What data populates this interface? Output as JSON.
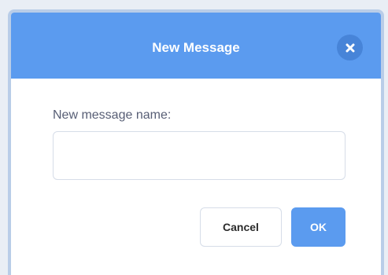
{
  "dialog": {
    "title": "New Message",
    "close_icon": "close-icon",
    "field_label": "New message name:",
    "input_value": "",
    "input_placeholder": "",
    "cancel_label": "Cancel",
    "ok_label": "OK"
  },
  "colors": {
    "header": "#5b9bef",
    "close_button": "#4784d8",
    "ok_button": "#5b9bef",
    "label_text": "#575e75"
  }
}
